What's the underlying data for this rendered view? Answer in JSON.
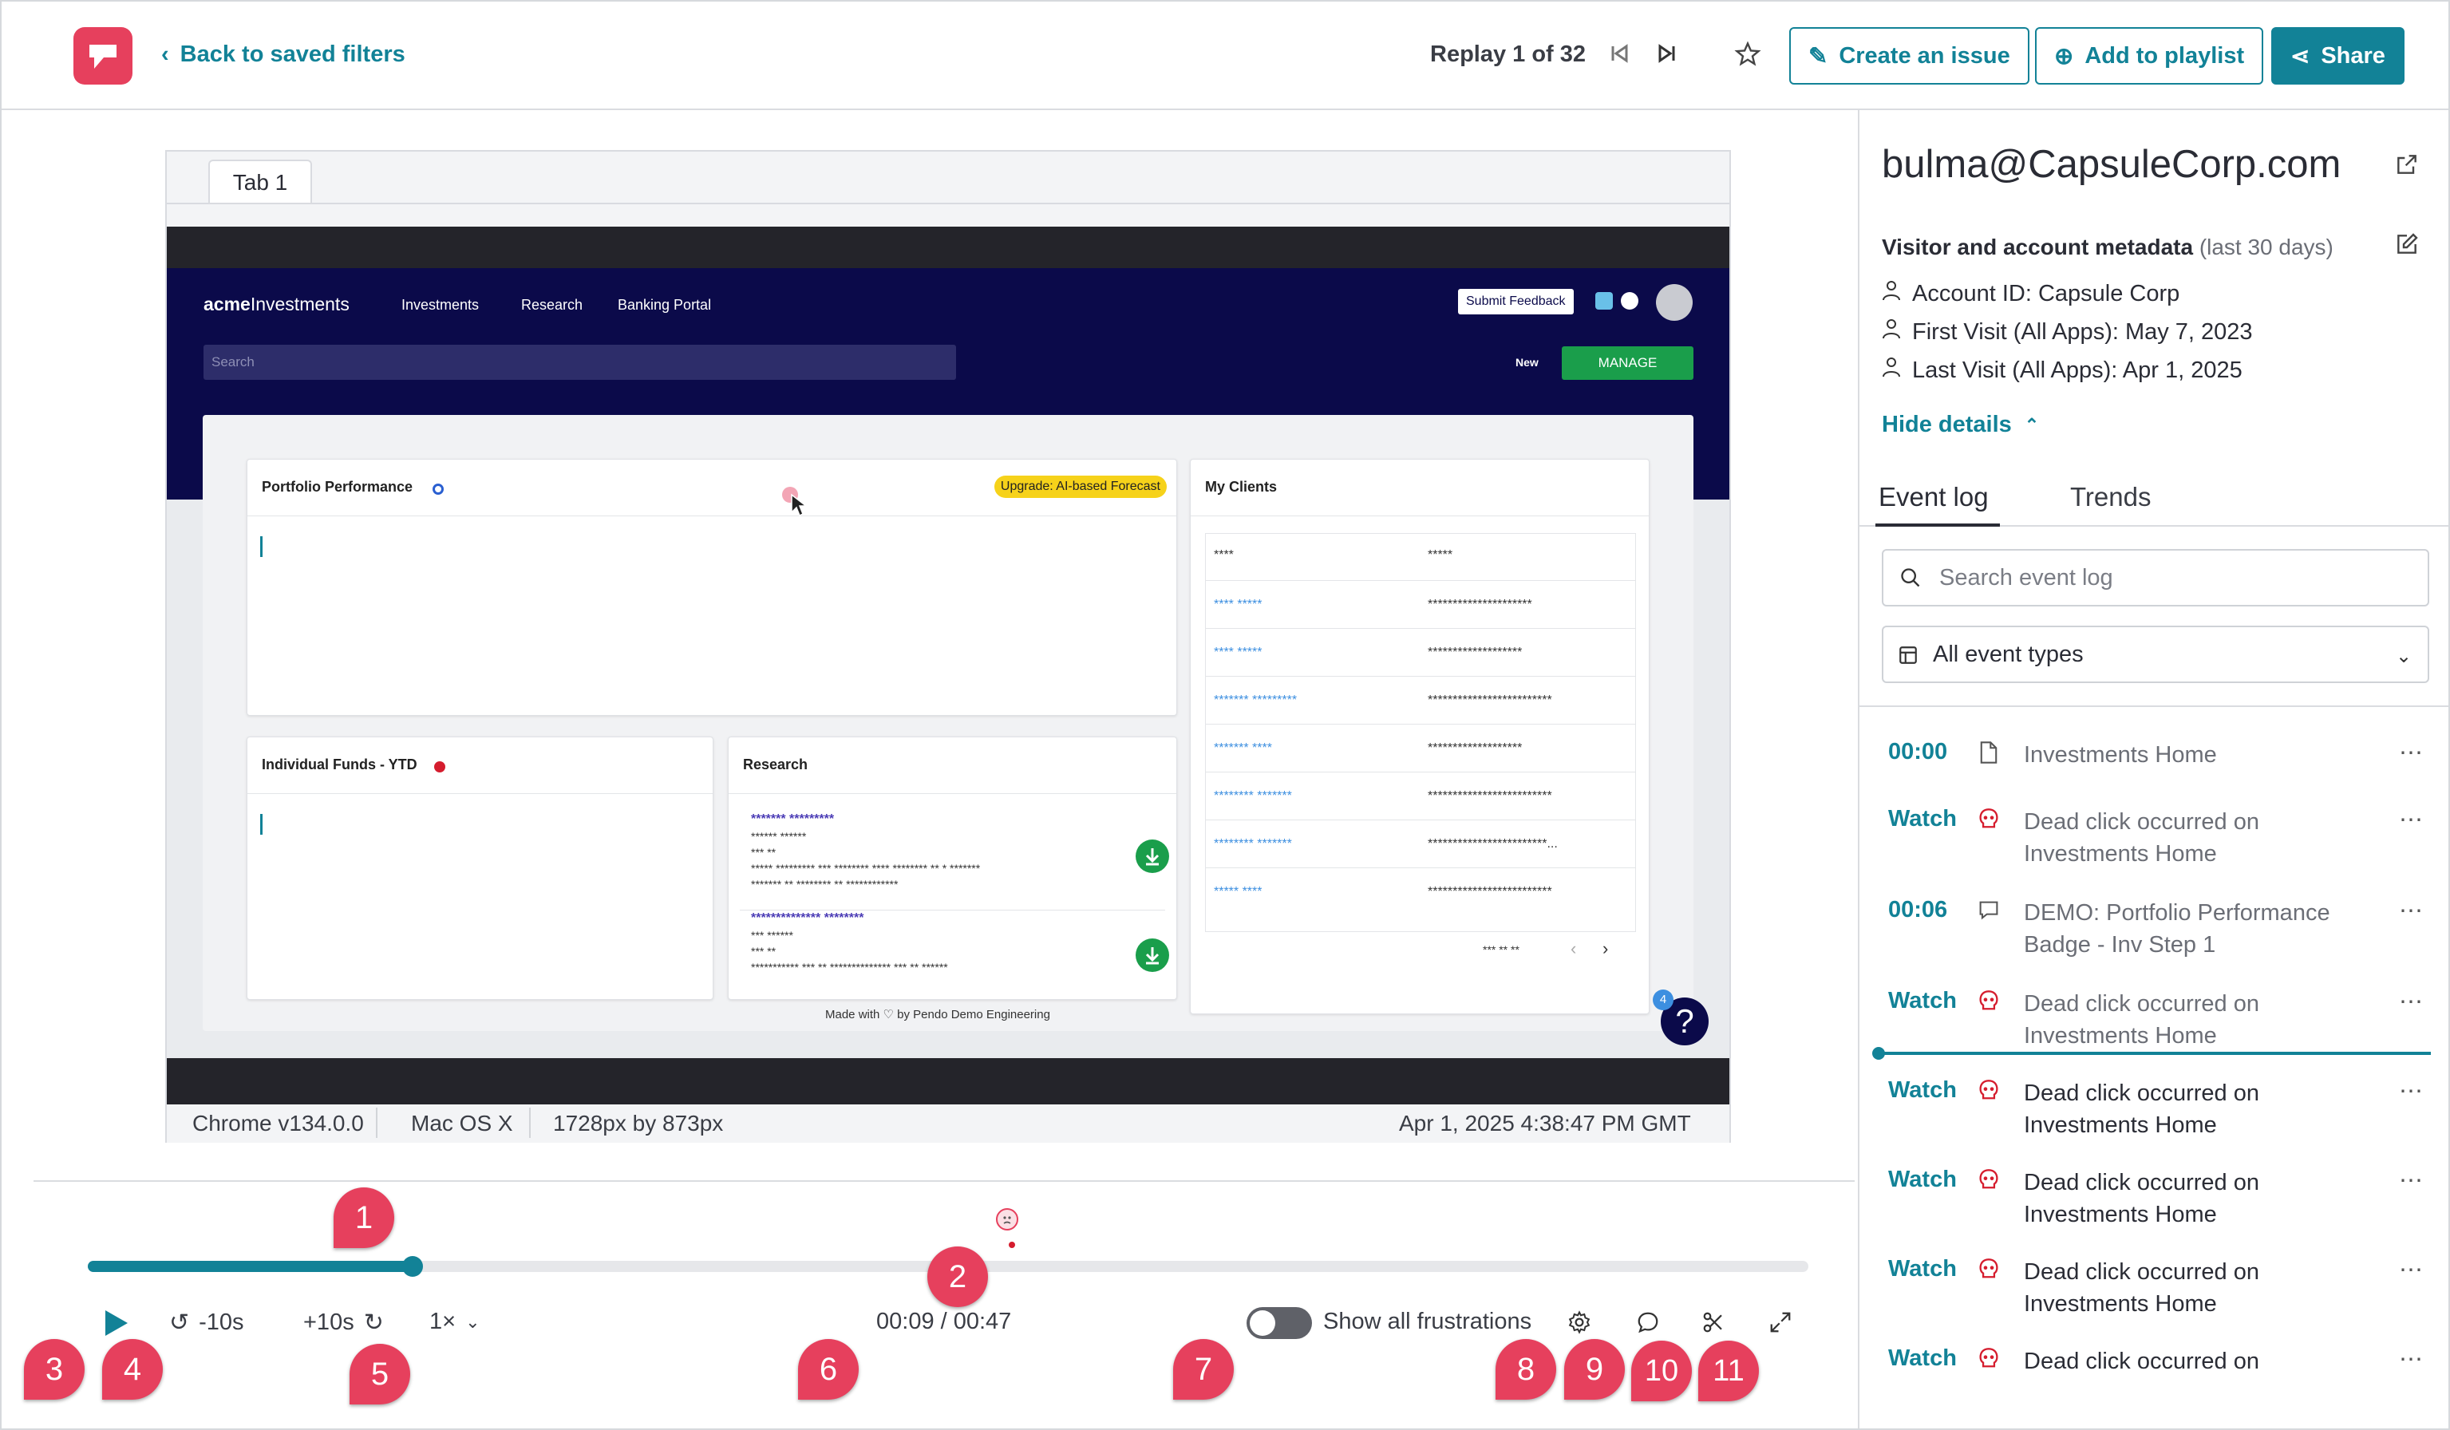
{
  "header": {
    "back_label": "Back to saved filters",
    "replay_counter": "Replay 1 of 32",
    "create_issue": "Create an issue",
    "add_playlist": "Add to playlist",
    "share": "Share"
  },
  "player": {
    "tab_label": "Tab 1",
    "app": {
      "brand_a": "acme",
      "brand_b": "Investments",
      "nav": [
        "Investments",
        "Research",
        "Banking Portal"
      ],
      "feedback": "Submit Feedback",
      "search_placeholder": "Search",
      "new_label": "New",
      "manage_label": "MANAGE",
      "portfolio_title": "Portfolio Performance",
      "upgrade_badge": "Upgrade: AI-based Forecast",
      "clients_title": "My Clients",
      "clients_head": [
        "****",
        "*****"
      ],
      "clients_rows": [
        [
          "**** *****",
          "*********************"
        ],
        [
          "**** *****",
          "*******************"
        ],
        [
          "******* *********",
          "*************************"
        ],
        [
          "******* ****",
          "*******************"
        ],
        [
          "******** *******",
          "*************************"
        ],
        [
          "******** *******",
          "************************..."
        ],
        [
          "***** ****",
          "*************************"
        ]
      ],
      "clients_pager": "*** ** **",
      "funds_title": "Individual Funds - YTD",
      "research_title": "Research",
      "research_items": [
        {
          "title": "******* *********",
          "lines": [
            "****** ******",
            "*** **",
            "***** ********* *** ******** **** ******** ** * *******",
            "******* ** ******** ** ************"
          ]
        },
        {
          "title": "************** ********",
          "lines": [
            "*** ******",
            "*** **",
            "*********** *** ** ************** *** ** ******"
          ]
        }
      ],
      "made_with": "Made with ♡ by Pendo Demo Engineering",
      "help_badge": "4",
      "help_glyph": "?"
    },
    "info": {
      "browser": "Chrome v134.0.0",
      "os": "Mac OS X",
      "resolution": "1728px by 873px",
      "datetime": "Apr 1, 2025 4:38:47 PM GMT"
    }
  },
  "controls": {
    "progress": 0.19,
    "rewind": "-10s",
    "forward": "+10s",
    "speed": "1×",
    "time": "00:09 / 00:47",
    "frustrations_label": "Show all frustrations",
    "frustrations_on": false
  },
  "markers": [
    "1",
    "2",
    "3",
    "4",
    "5",
    "6",
    "7",
    "8",
    "9",
    "10",
    "11"
  ],
  "sidebar": {
    "email": "bulma@CapsuleCorp.com",
    "meta_title": "Visitor and account metadata",
    "meta_range": "(last 30 days)",
    "account": "Account ID: Capsule Corp",
    "first_visit": "First Visit (All Apps): May 7, 2023",
    "last_visit": "Last Visit (All Apps): Apr 1, 2025",
    "hide_details": "Hide details",
    "tab_event_log": "Event log",
    "tab_trends": "Trends",
    "search_placeholder": "Search event log",
    "type_select": "All event types",
    "events": [
      {
        "time": "00:00",
        "icon": "page-icon",
        "text": "Investments Home",
        "bold": ""
      },
      {
        "time": "Watch",
        "icon": "skull-icon",
        "bold": "Dead click",
        "text": " occurred on Investments Home"
      },
      {
        "time": "00:06",
        "icon": "guide-icon",
        "text": "DEMO: Portfolio Performance Badge - Inv Step 1",
        "bold": ""
      },
      {
        "time": "Watch",
        "icon": "skull-icon",
        "bold": "Dead click",
        "text": " occurred on Investments Home"
      },
      {
        "time": "Watch",
        "icon": "skull-icon",
        "bold": "Dead click",
        "text": " occurred on Investments Home"
      },
      {
        "time": "Watch",
        "icon": "skull-icon",
        "bold": "Dead click",
        "text": " occurred on Investments Home"
      },
      {
        "time": "Watch",
        "icon": "skull-icon",
        "bold": "Dead click",
        "text": " occurred on Investments Home"
      },
      {
        "time": "Watch",
        "icon": "skull-icon",
        "bold": "Dead click",
        "text": " occurred on"
      }
    ]
  }
}
